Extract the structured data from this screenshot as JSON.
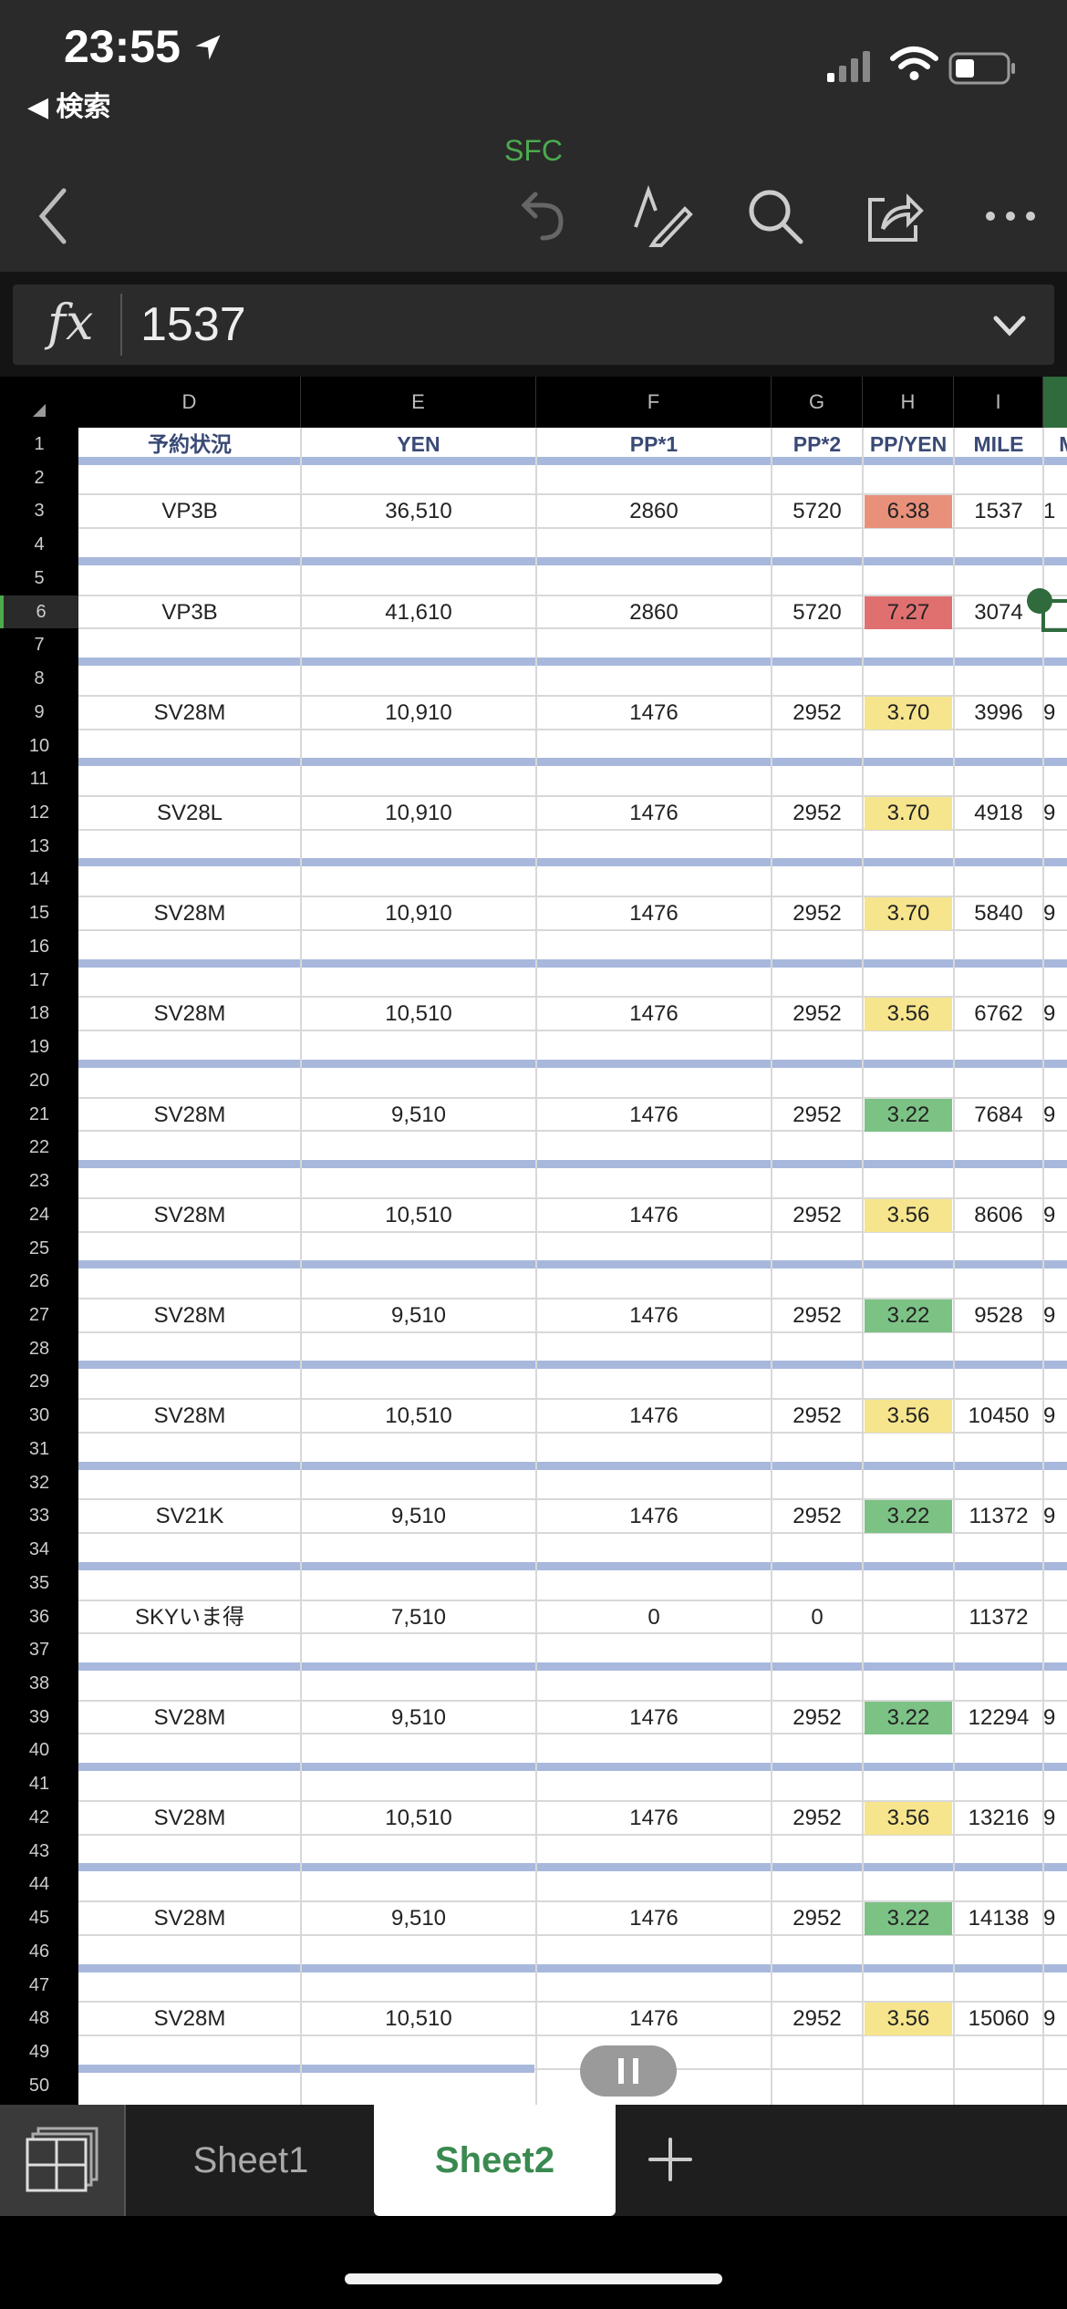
{
  "status": {
    "time": "23:55",
    "back_label": "◀ 検索"
  },
  "toolbar": {
    "title": "SFC"
  },
  "formula": {
    "fx": "fx",
    "value": "1537"
  },
  "columns": [
    "D",
    "E",
    "F",
    "G",
    "H",
    "I"
  ],
  "header_row": {
    "D": "予約状況",
    "E": "YEN",
    "F": "PP*1",
    "G": "PP*2",
    "H": "PP/YEN",
    "I": "MILE",
    "J": "MI"
  },
  "rows": [
    {
      "row": 3,
      "d": "VP3B",
      "e": "36,510",
      "f": "2860",
      "g": "5720",
      "h": "6.38",
      "i": "1537",
      "j": "1",
      "color": "#e8907a"
    },
    {
      "row": 6,
      "d": "VP3B",
      "e": "41,610",
      "f": "2860",
      "g": "5720",
      "h": "7.27",
      "i": "3074",
      "j": "",
      "color": "#e07070"
    },
    {
      "row": 9,
      "d": "SV28M",
      "e": "10,910",
      "f": "1476",
      "g": "2952",
      "h": "3.70",
      "i": "3996",
      "j": "9",
      "color": "#f6e58c"
    },
    {
      "row": 12,
      "d": "SV28L",
      "e": "10,910",
      "f": "1476",
      "g": "2952",
      "h": "3.70",
      "i": "4918",
      "j": "9",
      "color": "#f6e58c"
    },
    {
      "row": 15,
      "d": "SV28M",
      "e": "10,910",
      "f": "1476",
      "g": "2952",
      "h": "3.70",
      "i": "5840",
      "j": "9",
      "color": "#f6e58c"
    },
    {
      "row": 18,
      "d": "SV28M",
      "e": "10,510",
      "f": "1476",
      "g": "2952",
      "h": "3.56",
      "i": "6762",
      "j": "9",
      "color": "#f6e58c"
    },
    {
      "row": 21,
      "d": "SV28M",
      "e": "9,510",
      "f": "1476",
      "g": "2952",
      "h": "3.22",
      "i": "7684",
      "j": "9",
      "color": "#7cc285"
    },
    {
      "row": 24,
      "d": "SV28M",
      "e": "10,510",
      "f": "1476",
      "g": "2952",
      "h": "3.56",
      "i": "8606",
      "j": "9",
      "color": "#f6e58c"
    },
    {
      "row": 27,
      "d": "SV28M",
      "e": "9,510",
      "f": "1476",
      "g": "2952",
      "h": "3.22",
      "i": "9528",
      "j": "9",
      "color": "#7cc285"
    },
    {
      "row": 30,
      "d": "SV28M",
      "e": "10,510",
      "f": "1476",
      "g": "2952",
      "h": "3.56",
      "i": "10450",
      "j": "9",
      "color": "#f6e58c"
    },
    {
      "row": 33,
      "d": "SV21K",
      "e": "9,510",
      "f": "1476",
      "g": "2952",
      "h": "3.22",
      "i": "11372",
      "j": "9",
      "color": "#7cc285"
    },
    {
      "row": 36,
      "d": "SKYいま得",
      "e": "7,510",
      "f": "0",
      "g": "0",
      "h": "",
      "i": "11372",
      "j": "",
      "color": ""
    },
    {
      "row": 39,
      "d": "SV28M",
      "e": "9,510",
      "f": "1476",
      "g": "2952",
      "h": "3.22",
      "i": "12294",
      "j": "9",
      "color": "#7cc285"
    },
    {
      "row": 42,
      "d": "SV28M",
      "e": "10,510",
      "f": "1476",
      "g": "2952",
      "h": "3.56",
      "i": "13216",
      "j": "9",
      "color": "#f6e58c"
    },
    {
      "row": 45,
      "d": "SV28M",
      "e": "9,510",
      "f": "1476",
      "g": "2952",
      "h": "3.22",
      "i": "14138",
      "j": "9",
      "color": "#7cc285"
    },
    {
      "row": 48,
      "d": "SV28M",
      "e": "10,510",
      "f": "1476",
      "g": "2952",
      "h": "3.56",
      "i": "15060",
      "j": "9",
      "color": "#f6e58c"
    }
  ],
  "tabs": {
    "sheet1": "Sheet1",
    "sheet2": "Sheet2"
  }
}
